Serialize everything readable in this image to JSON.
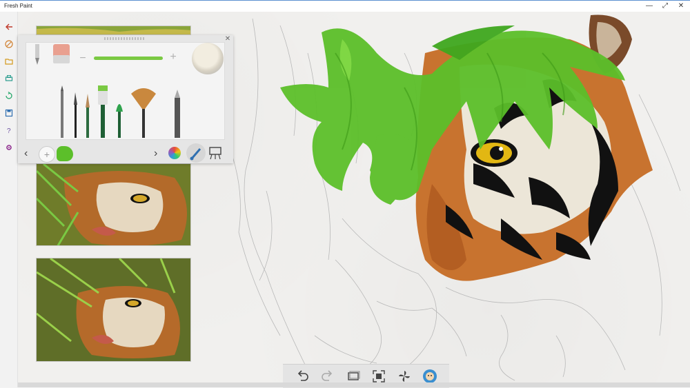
{
  "window": {
    "title": "Fresh Paint",
    "controls": {
      "minimize": "—",
      "restore": "⤢",
      "close": "✕"
    }
  },
  "appbar": {
    "items": [
      "back",
      "paint",
      "open",
      "print",
      "share",
      "save",
      "help",
      "settings"
    ]
  },
  "colors": {
    "accent": "#c0392b",
    "panel": "#e6e6e6",
    "brush_stroke": "#7ac943",
    "paint_green": "#5cbf2a",
    "palette_accent": "#2f6fb0"
  },
  "palette": {
    "size_minus": "−",
    "size_plus": "+",
    "tools": [
      "eraser",
      "pencil",
      "fine-brush",
      "round-brush",
      "flat-brush",
      "wide-flat-brush",
      "fan-brush",
      "graphite-pencil"
    ],
    "nav_prev": "‹",
    "nav_next": "›"
  },
  "toolbar": {
    "buttons": [
      "undo",
      "redo",
      "layer",
      "fit-to-screen",
      "pinwheel",
      "face"
    ]
  }
}
